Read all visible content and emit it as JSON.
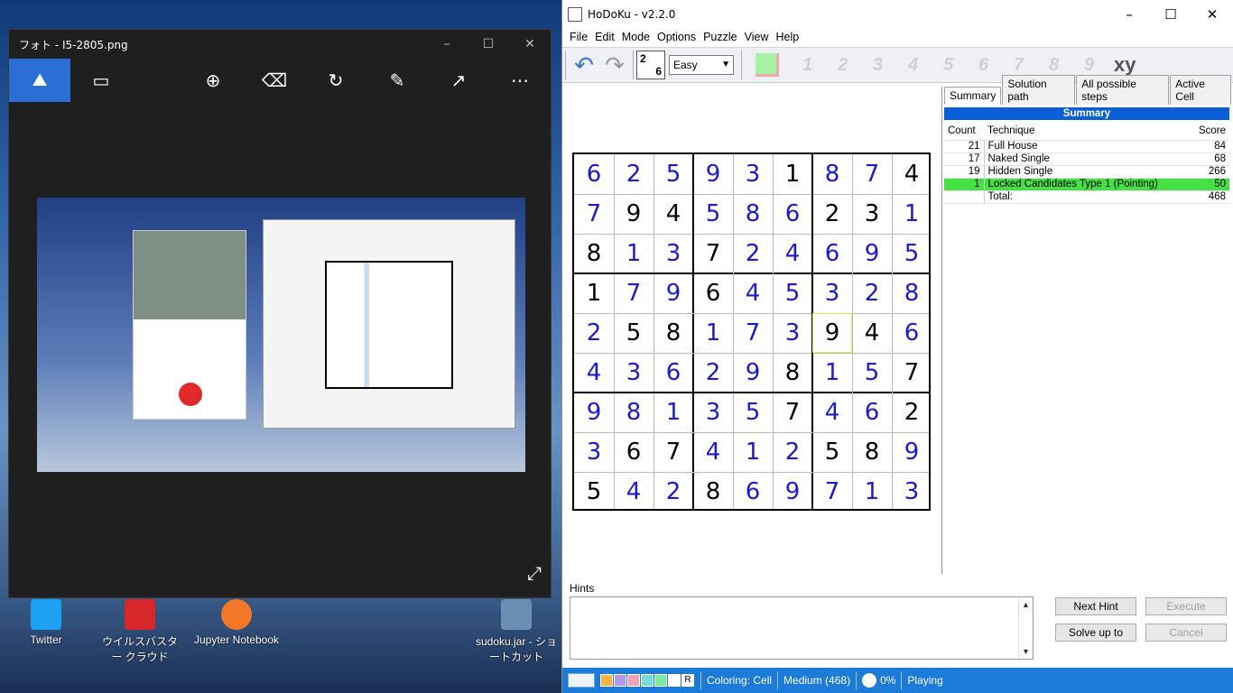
{
  "desktop": {
    "icons": [
      {
        "label": "Twitter",
        "color": "#1da1f2"
      },
      {
        "label": "ウイルスバスター クラウド",
        "color": "#d6272b"
      },
      {
        "label": "Jupyter Notebook",
        "color": "#f37726"
      },
      {
        "label": "sudoku.jar - ショートカット",
        "color": "#6b8fb3"
      }
    ]
  },
  "photos": {
    "title": "フォト - I5-2805.png",
    "toolbar": [
      "image-icon",
      "slideshow-icon",
      "zoom-icon",
      "delete-icon",
      "rotate-icon",
      "edit-icon",
      "share-icon",
      "more-icon"
    ]
  },
  "hodoku": {
    "title": "HoDoKu - v2.2.0",
    "menu": [
      "File",
      "Edit",
      "Mode",
      "Options",
      "Puzzle",
      "View",
      "Help"
    ],
    "level_icon": {
      "top": "2",
      "bottom": "6"
    },
    "difficulty": "Easy",
    "filter_digits": [
      "1",
      "2",
      "3",
      "4",
      "5",
      "6",
      "7",
      "8",
      "9"
    ],
    "xy_label": "xy",
    "grid": [
      [
        6,
        2,
        5,
        9,
        3,
        1,
        8,
        7,
        4
      ],
      [
        7,
        9,
        4,
        5,
        8,
        6,
        2,
        3,
        1
      ],
      [
        8,
        1,
        3,
        7,
        2,
        4,
        6,
        9,
        5
      ],
      [
        1,
        7,
        9,
        6,
        4,
        5,
        3,
        2,
        8
      ],
      [
        2,
        5,
        8,
        1,
        7,
        3,
        9,
        4,
        6
      ],
      [
        4,
        3,
        6,
        2,
        9,
        8,
        1,
        5,
        7
      ],
      [
        9,
        8,
        1,
        3,
        5,
        7,
        4,
        6,
        2
      ],
      [
        3,
        6,
        7,
        4,
        1,
        2,
        5,
        8,
        9
      ],
      [
        5,
        4,
        2,
        8,
        6,
        9,
        7,
        1,
        3
      ]
    ],
    "givens": [
      [
        0,
        0,
        0,
        0,
        0,
        1,
        0,
        0,
        1
      ],
      [
        0,
        1,
        1,
        0,
        0,
        0,
        1,
        1,
        0
      ],
      [
        1,
        0,
        0,
        1,
        0,
        0,
        0,
        0,
        0
      ],
      [
        1,
        0,
        0,
        1,
        0,
        0,
        0,
        0,
        0
      ],
      [
        0,
        1,
        1,
        0,
        0,
        0,
        1,
        1,
        0
      ],
      [
        0,
        0,
        0,
        0,
        0,
        1,
        0,
        0,
        1
      ],
      [
        0,
        0,
        0,
        0,
        0,
        1,
        0,
        0,
        1
      ],
      [
        0,
        1,
        1,
        0,
        0,
        0,
        1,
        1,
        0
      ],
      [
        1,
        0,
        0,
        1,
        0,
        0,
        0,
        0,
        0
      ]
    ],
    "selected_cell": {
      "row": 4,
      "col": 6
    },
    "tabs": [
      "Summary",
      "Solution path",
      "All possible steps",
      "Active Cell"
    ],
    "summary": {
      "heading": "Summary",
      "headers": {
        "count": "Count",
        "technique": "Technique",
        "score": "Score"
      },
      "rows": [
        {
          "count": "21",
          "technique": "Full House",
          "score": "84"
        },
        {
          "count": "17",
          "technique": "Naked Single",
          "score": "68"
        },
        {
          "count": "19",
          "technique": "Hidden Single",
          "score": "266"
        },
        {
          "count": "1",
          "technique": "Locked Candidates Type 1 (Pointing)",
          "score": "50"
        }
      ],
      "total_label": "Total:",
      "total_score": "468"
    },
    "hints": {
      "label": "Hints",
      "next_hint": "Next Hint",
      "execute": "Execute",
      "solve_up_to": "Solve up to",
      "cancel": "Cancel"
    },
    "status": {
      "r_label": "R",
      "coloring": "Coloring: Cell",
      "level": "Medium (468)",
      "progress": "0%",
      "mode": "Playing",
      "colors": [
        "#f5b342",
        "#b39ae6",
        "#f2a1b0",
        "#79dada",
        "#7fe89a",
        "#ffffff"
      ]
    }
  }
}
